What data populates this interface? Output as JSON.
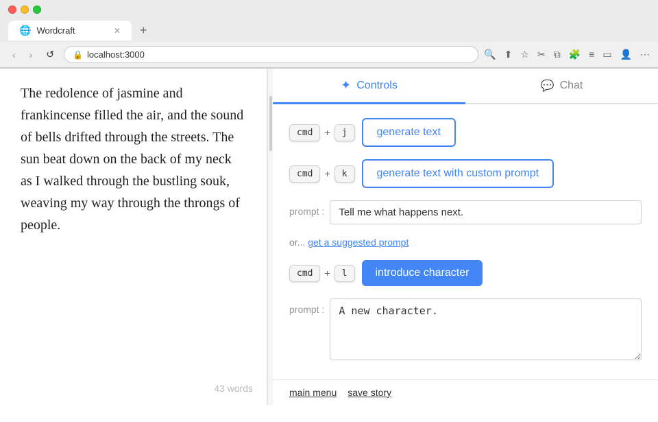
{
  "browser": {
    "tab_title": "Wordcraft",
    "address": "localhost:3000",
    "new_tab_label": "+"
  },
  "editor": {
    "text": "The redolence of jasmine and frankincense filled the air, and the sound of bells drifted through the streets. The sun beat down on the back of my neck as I walked through the bustling souk, weaving my way through the throngs of people.",
    "word_count": "43 words"
  },
  "controls": {
    "tab_controls_label": "Controls",
    "tab_chat_label": "Chat",
    "generate_text_label": "generate text",
    "generate_text_custom_label": "generate text with custom prompt",
    "introduce_character_label": "introduce character",
    "cmd_j_key1": "cmd",
    "cmd_j_plus": "+",
    "cmd_j_key2": "j",
    "cmd_k_key1": "cmd",
    "cmd_k_plus": "+",
    "cmd_k_key2": "k",
    "cmd_l_key1": "cmd",
    "cmd_l_plus": "+",
    "cmd_l_key2": "l",
    "prompt_label": "prompt :",
    "prompt_value": "Tell me what happens next.",
    "or_text": "or...",
    "get_suggested_label": "get a suggested prompt",
    "character_prompt_value": "A new character.",
    "main_menu_label": "main menu",
    "save_story_label": "save story"
  }
}
